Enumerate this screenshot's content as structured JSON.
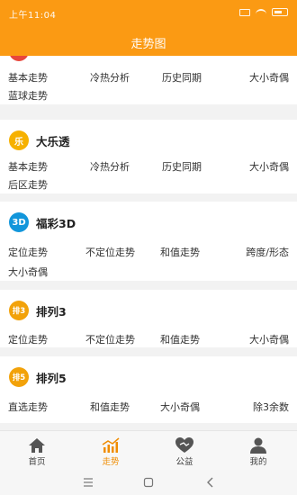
{
  "status_bar": {
    "time": "上午11:04"
  },
  "header": {
    "title": "走势图"
  },
  "colors": {
    "accent": "#fb9a13",
    "daletou_badge": "#f6b100",
    "fucai_badge": "#1296db",
    "pailie_badge": "#f2a20a"
  },
  "sections": [
    {
      "rows": [
        [
          "基本走势",
          "冷热分析",
          "历史同期",
          "大小奇偶"
        ],
        [
          "蓝球走势"
        ]
      ]
    },
    {
      "badge": "乐",
      "title": "大乐透",
      "rows": [
        [
          "基本走势",
          "冷热分析",
          "历史同期",
          "大小奇偶"
        ],
        [
          "后区走势"
        ]
      ]
    },
    {
      "badge": "3D",
      "title": "福彩3D",
      "rows": [
        [
          "定位走势",
          "不定位走势",
          "和值走势",
          "跨度/形态"
        ],
        [
          "大小奇偶"
        ]
      ]
    },
    {
      "badge": "排3",
      "title": "排列3",
      "rows": [
        [
          "定位走势",
          "不定位走势",
          "和值走势",
          "大小奇偶"
        ]
      ]
    },
    {
      "badge": "排5",
      "title": "排列5",
      "rows": [
        [
          "直选走势",
          "和值走势",
          "大小奇偶",
          "除3余数"
        ]
      ]
    }
  ],
  "tabs": [
    {
      "label": "首页",
      "icon": "home-icon"
    },
    {
      "label": "走势",
      "icon": "trend-chart-icon"
    },
    {
      "label": "公益",
      "icon": "charity-heart-icon"
    },
    {
      "label": "我的",
      "icon": "user-profile-icon"
    }
  ],
  "system_nav": {
    "menu": "menu-icon",
    "home": "home-square-icon",
    "back": "back-icon"
  }
}
